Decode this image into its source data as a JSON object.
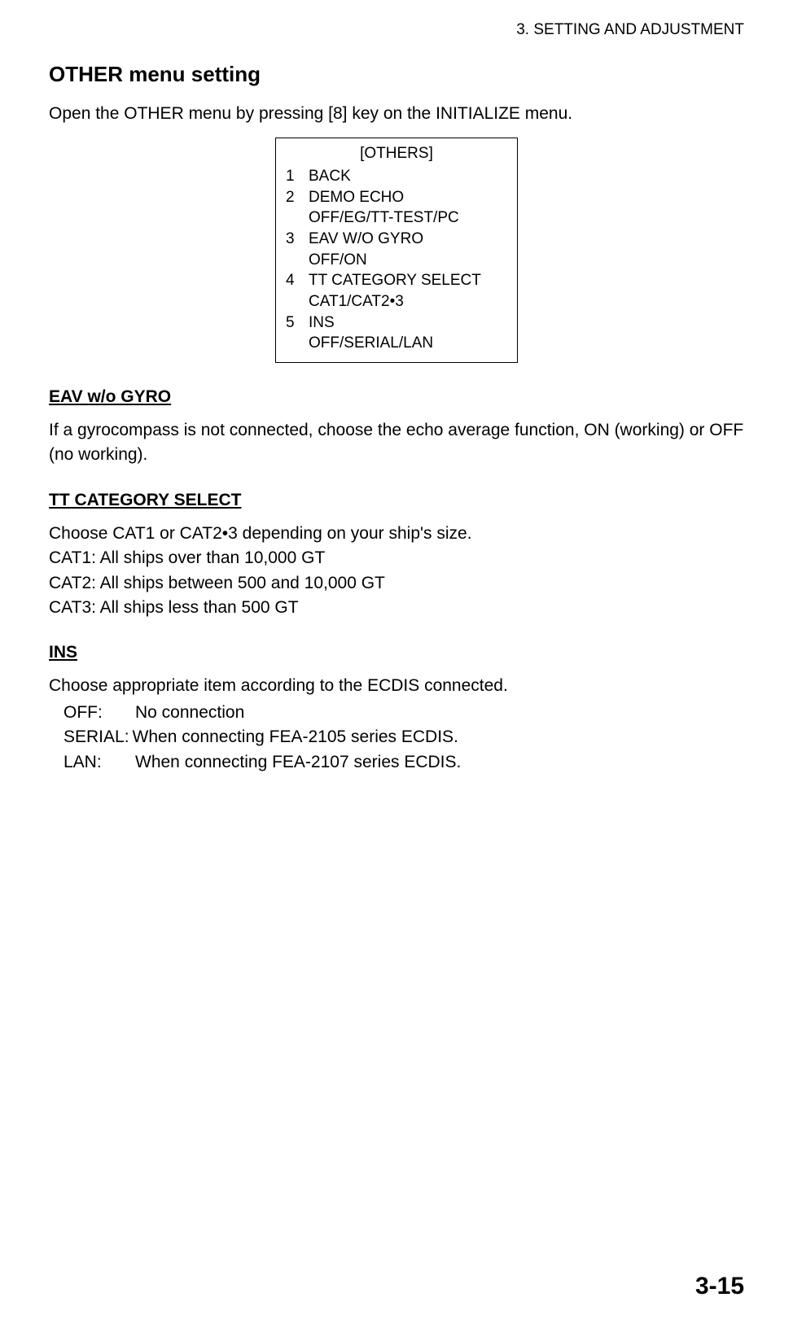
{
  "running_header": "3. SETTING AND ADJUSTMENT",
  "h2": "OTHER menu setting",
  "intro": "Open the OTHER menu by pressing [8] key on the INITIALIZE menu.",
  "menu": {
    "title": "[OTHERS]",
    "items": [
      {
        "num": "1",
        "label": "BACK",
        "sub": ""
      },
      {
        "num": "2",
        "label": "DEMO ECHO",
        "sub": "OFF/EG/TT-TEST/PC"
      },
      {
        "num": "3",
        "label": "EAV W/O GYRO",
        "sub": "OFF/ON"
      },
      {
        "num": "4",
        "label": "TT CATEGORY SELECT",
        "sub": "CAT1/CAT2•3"
      },
      {
        "num": "5",
        "label": "INS",
        "sub": "OFF/SERIAL/LAN"
      }
    ]
  },
  "sections": {
    "eav": {
      "heading": "EAV w/o GYRO",
      "body": "If a gyrocompass is not connected, choose the echo average function, ON (working) or OFF (no working)."
    },
    "tt": {
      "heading": "TT CATEGORY SELECT",
      "line1": "Choose CAT1 or CAT2•3 depending on your ship's size.",
      "line2": "CAT1: All ships over than 10,000 GT",
      "line3": "CAT2: All ships between 500 and 10,000 GT",
      "line4": "CAT3: All ships less than 500 GT"
    },
    "ins": {
      "heading": "INS",
      "body": "Choose appropriate item according to the ECDIS connected.",
      "rows": [
        {
          "key": "OFF:",
          "val": "No connection"
        },
        {
          "key": "SERIAL:",
          "val": "When connecting FEA-2105 series ECDIS."
        },
        {
          "key": "LAN:",
          "val": "When connecting FEA-2107 series ECDIS."
        }
      ]
    }
  },
  "page_number": "3-15"
}
